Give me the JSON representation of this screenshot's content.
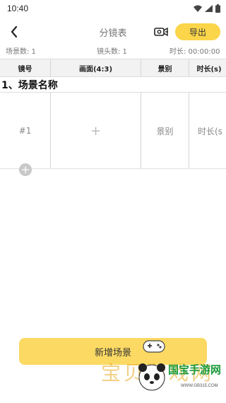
{
  "status": {
    "time": "10:40"
  },
  "header": {
    "title": "分镜表",
    "export_label": "导出"
  },
  "info": {
    "scene_count": "场景数: 1",
    "shot_count": "镜头数: 1",
    "duration": "时长: 00:00:00"
  },
  "table": {
    "columns": [
      "镜号",
      "画面(4:3)",
      "景别",
      "时长(s)"
    ]
  },
  "scene": {
    "name": "1、场景名称",
    "shots": [
      {
        "number": "#1",
        "image_placeholder": "+",
        "shot_size": "景别",
        "duration": "时长(s"
      }
    ]
  },
  "actions": {
    "add_shot": "+",
    "add_scene": "新增场景"
  },
  "watermark": {
    "text": "宝贝游戏网",
    "site": "国宝手游网",
    "domain": "WWW.GB315.COM"
  },
  "colors": {
    "accent": "#fbd54a",
    "watermark_green": "#1a9b3c"
  },
  "icons": {
    "back": "chevron-left-icon",
    "camera": "camera-settings-icon",
    "wifi": "wifi-icon",
    "signal": "signal-icon",
    "battery": "battery-icon"
  }
}
